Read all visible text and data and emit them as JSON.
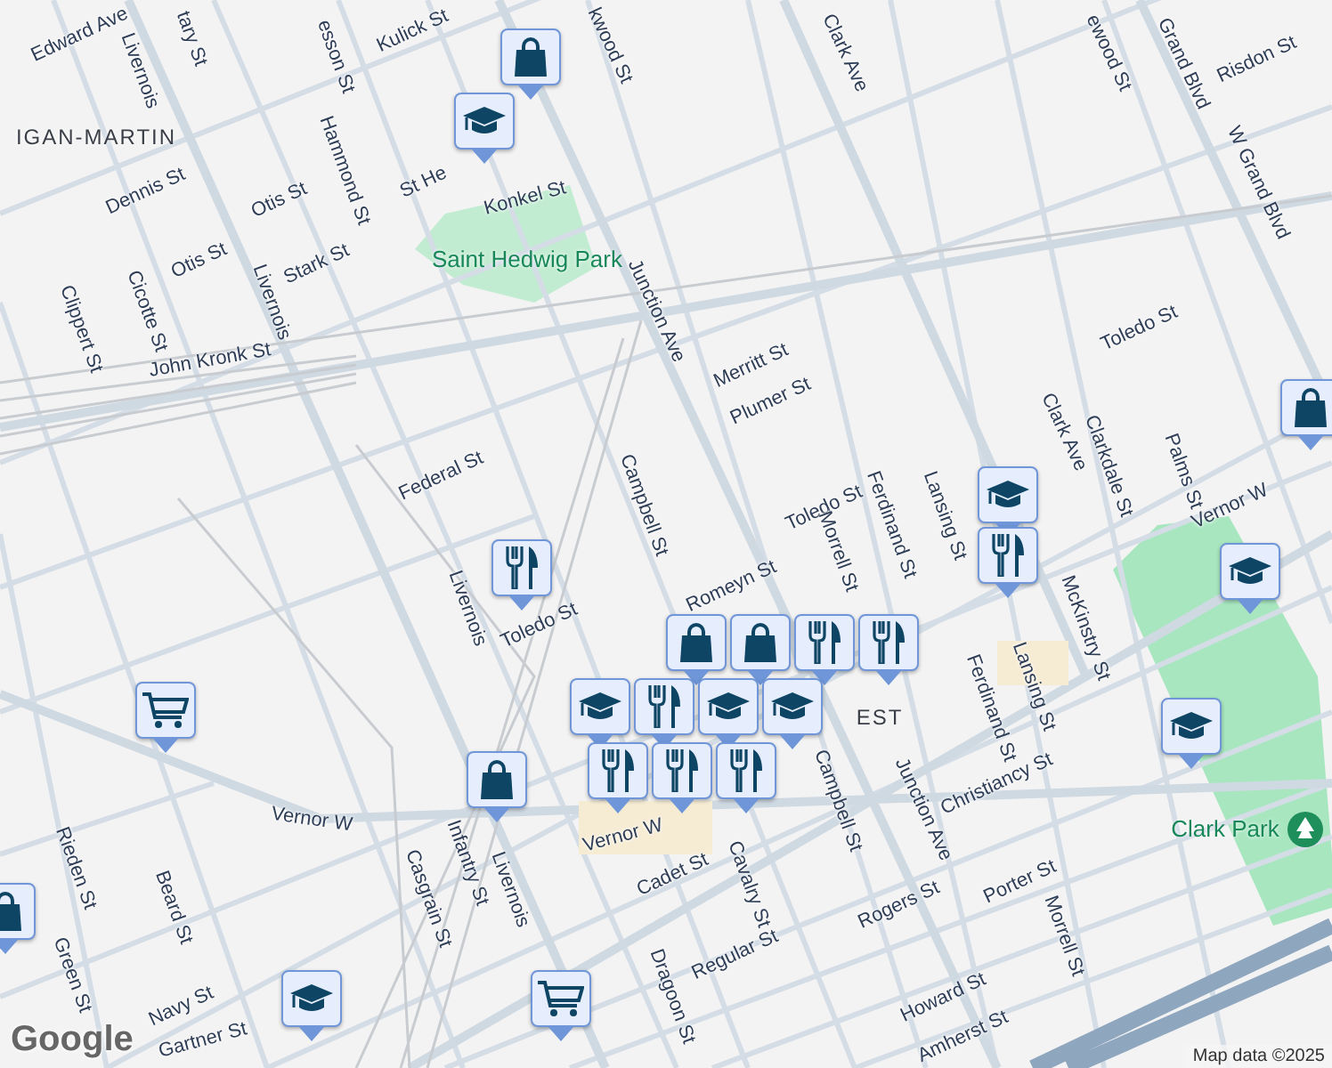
{
  "map": {
    "street_labels": [
      {
        "text": "Edward Ave"
      },
      {
        "text": "Livernois"
      },
      {
        "text": "tary St"
      },
      {
        "text": "esson St"
      },
      {
        "text": "Kulick St"
      },
      {
        "text": "kwood St"
      },
      {
        "text": "Dennis St"
      },
      {
        "text": "Otis St"
      },
      {
        "text": "Otis St"
      },
      {
        "text": "Hammond St"
      },
      {
        "text": "Stark St"
      },
      {
        "text": "St He"
      },
      {
        "text": "Konkel St"
      },
      {
        "text": "Junction Ave"
      },
      {
        "text": "Clippert St"
      },
      {
        "text": "Cicotte St"
      },
      {
        "text": "Livernois"
      },
      {
        "text": "John Kronk St"
      },
      {
        "text": "Merritt St"
      },
      {
        "text": "Plumer St"
      },
      {
        "text": "Federal St"
      },
      {
        "text": "Campbell St"
      },
      {
        "text": "Clark Ave"
      },
      {
        "text": "ewood St"
      },
      {
        "text": "Grand Blvd"
      },
      {
        "text": "Risdon St"
      },
      {
        "text": "W Grand Blvd"
      },
      {
        "text": "Toledo St"
      },
      {
        "text": "Toledo St"
      },
      {
        "text": "Clark Ave"
      },
      {
        "text": "Clarkdale St"
      },
      {
        "text": "Palms St"
      },
      {
        "text": "Vernor W"
      },
      {
        "text": "Morrell St"
      },
      {
        "text": "Ferdinand St"
      },
      {
        "text": "Lansing St"
      },
      {
        "text": "Romeyn St"
      },
      {
        "text": "Toledo St"
      },
      {
        "text": "Livernois"
      },
      {
        "text": "McKinstry St"
      },
      {
        "text": "Lansing St"
      },
      {
        "text": "Ferdinand St"
      },
      {
        "text": "Christiancy St"
      },
      {
        "text": "Junction Ave"
      },
      {
        "text": "Campbell St"
      },
      {
        "text": "Cavalry St"
      },
      {
        "text": "Porter St"
      },
      {
        "text": "Rogers St"
      },
      {
        "text": "Morrell St"
      },
      {
        "text": "Regular St"
      },
      {
        "text": "Howard St"
      },
      {
        "text": "Amherst St"
      },
      {
        "text": "Cadet St"
      },
      {
        "text": "Dragoon St"
      },
      {
        "text": "Livernois"
      },
      {
        "text": "Infantry St"
      },
      {
        "text": "Casgrain St"
      },
      {
        "text": "Vernor W"
      },
      {
        "text": "Vernor W"
      },
      {
        "text": "Rieden St"
      },
      {
        "text": "Beard St"
      },
      {
        "text": "Green St"
      },
      {
        "text": "Navy St"
      },
      {
        "text": "Gartner St"
      }
    ],
    "neighborhood_labels": [
      {
        "text": "IGAN-MARTIN"
      },
      {
        "text": "EST"
      }
    ],
    "parks": [
      {
        "name": "Saint Hedwig Park"
      },
      {
        "name": "Clark Park"
      }
    ],
    "markers": [
      {
        "kind": "shopping"
      },
      {
        "kind": "school"
      },
      {
        "kind": "restaurant"
      },
      {
        "kind": "grocery"
      },
      {
        "kind": "shopping"
      },
      {
        "kind": "shopping"
      },
      {
        "kind": "school"
      },
      {
        "kind": "grocery"
      },
      {
        "kind": "school"
      },
      {
        "kind": "restaurant"
      },
      {
        "kind": "shopping"
      },
      {
        "kind": "school"
      },
      {
        "kind": "school"
      },
      {
        "kind": "shopping"
      },
      {
        "kind": "shopping"
      },
      {
        "kind": "restaurant"
      },
      {
        "kind": "restaurant"
      },
      {
        "kind": "school"
      },
      {
        "kind": "restaurant"
      },
      {
        "kind": "school"
      },
      {
        "kind": "school"
      },
      {
        "kind": "restaurant"
      },
      {
        "kind": "restaurant"
      },
      {
        "kind": "restaurant"
      }
    ]
  },
  "logo": "Google",
  "attribution": "Map data ©2025"
}
